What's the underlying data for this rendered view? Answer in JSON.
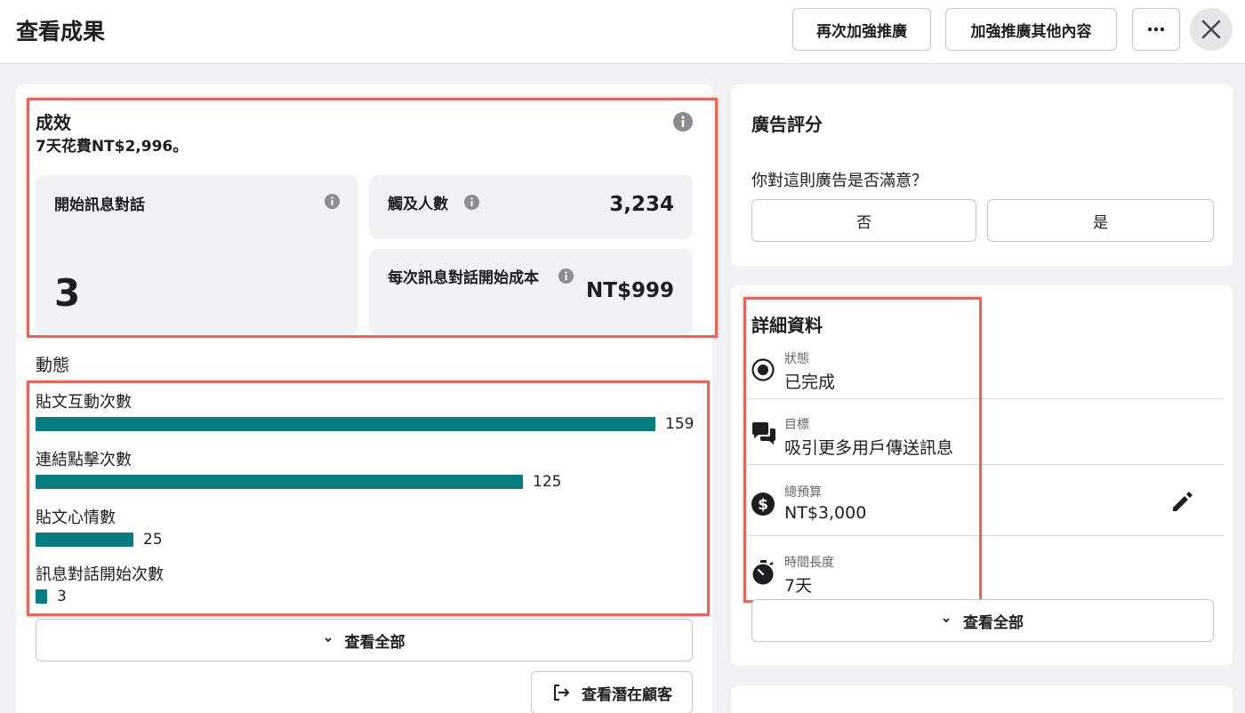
{
  "header": {
    "title": "查看成果",
    "boost_again_label": "再次加強推廣",
    "boost_other_label": "加強推廣其他內容",
    "more_icon": "more-horizontal-icon",
    "close_icon": "close-icon"
  },
  "performance": {
    "title": "成效",
    "subtitle": "7天花費NT$2,996。",
    "messaging": {
      "label": "開始訊息對話",
      "value": "3"
    },
    "reach": {
      "label": "觸及人數",
      "value": "3,234"
    },
    "cost_per": {
      "label": "每次訊息對話開始成本",
      "value": "NT$999"
    }
  },
  "activity": {
    "title": "動態",
    "max": 159,
    "items": [
      {
        "label": "貼文互動次數",
        "value": 159
      },
      {
        "label": "連結點擊次數",
        "value": 125
      },
      {
        "label": "貼文心情數",
        "value": 25
      },
      {
        "label": "訊息對話開始次數",
        "value": 3
      }
    ],
    "view_all_label": "查看全部",
    "view_leads_label": "查看潛在顧客"
  },
  "rating": {
    "title": "廣告評分",
    "question": "你對這則廣告是否滿意？",
    "no_label": "否",
    "yes_label": "是"
  },
  "details": {
    "title": "詳細資料",
    "rows": [
      {
        "label": "狀態",
        "value": "已完成",
        "icon": "status-radio-icon"
      },
      {
        "label": "目標",
        "value": "吸引更多用戶傳送訊息",
        "icon": "chat-bubbles-icon"
      },
      {
        "label": "總預算",
        "value": "NT$3,000",
        "icon": "dollar-icon"
      },
      {
        "label": "時間長度",
        "value": "7天",
        "icon": "stopwatch-icon"
      }
    ],
    "view_all_label": "查看全部"
  },
  "colors": {
    "bar": "#087c80",
    "highlight": "#e2665c",
    "background": "#f0f2f5"
  }
}
